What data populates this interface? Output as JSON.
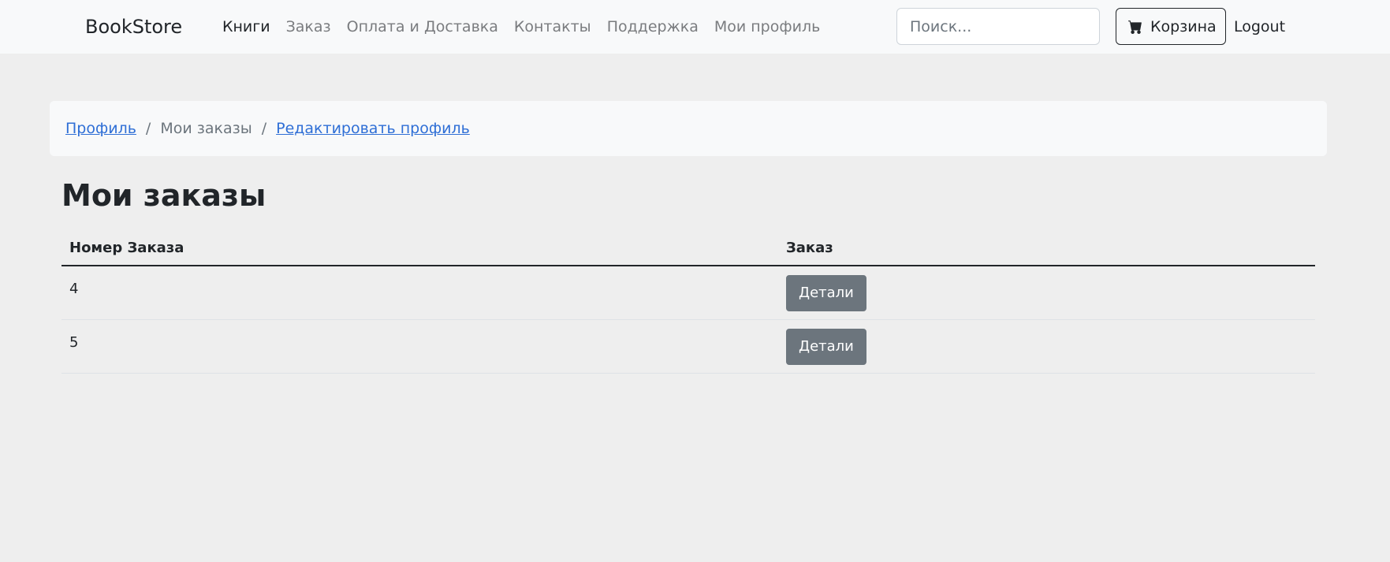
{
  "navbar": {
    "brand": "BookStore",
    "links": [
      {
        "label": "Книги",
        "active": true
      },
      {
        "label": "Заказ",
        "active": false
      },
      {
        "label": "Оплата и Доставка",
        "active": false
      },
      {
        "label": "Контакты",
        "active": false
      },
      {
        "label": "Поддержка",
        "active": false
      },
      {
        "label": "Мои профиль",
        "active": false
      }
    ],
    "search_placeholder": "Поиск...",
    "cart_label": "Корзина",
    "cart_icon": "cart-icon",
    "logout_label": "Logout"
  },
  "breadcrumb": {
    "items": [
      {
        "label": "Профиль",
        "link": true
      },
      {
        "label": "Мои заказы",
        "link": false
      },
      {
        "label": "Редактировать профиль",
        "link": true
      }
    ],
    "separator": "/"
  },
  "page": {
    "title": "Мои заказы"
  },
  "orders_table": {
    "headers": [
      "Номер Заказа",
      "Заказ"
    ],
    "rows": [
      {
        "order_number": "4",
        "action_label": "Детали"
      },
      {
        "order_number": "5",
        "action_label": "Детали"
      }
    ]
  },
  "colors": {
    "page_bg": "#eeeeee",
    "navbar_bg": "#f8f9fa",
    "link": "#2f6fd6",
    "secondary_button": "#6c757d"
  }
}
